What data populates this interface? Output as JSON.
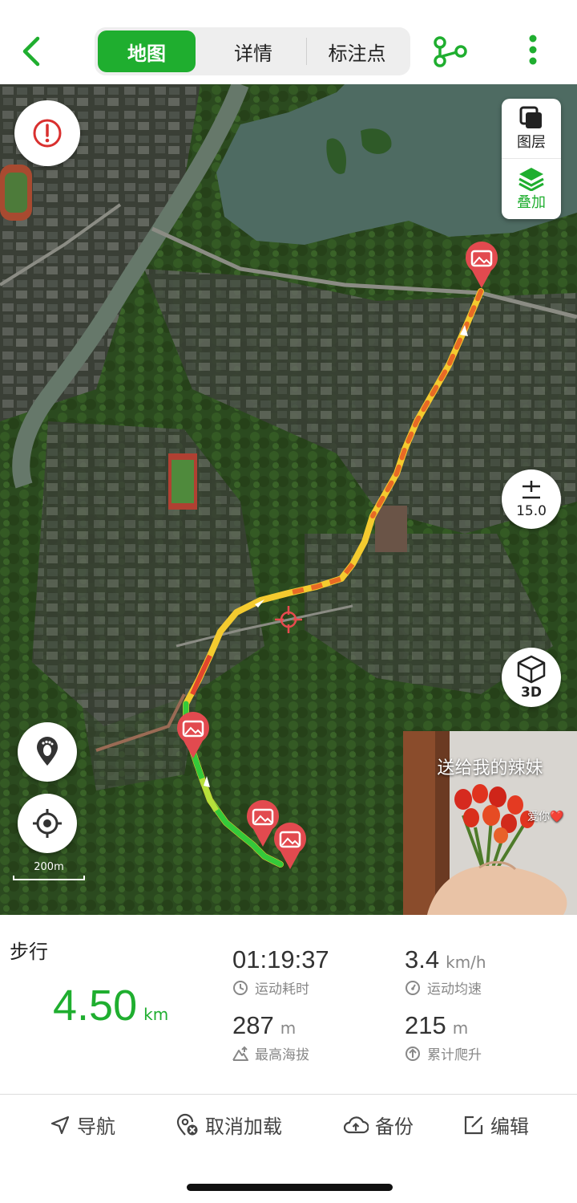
{
  "header": {
    "tabs": [
      {
        "label": "地图",
        "active": true
      },
      {
        "label": "详情",
        "active": false
      },
      {
        "label": "标注点",
        "active": false
      }
    ]
  },
  "map": {
    "layer_label": "图层",
    "overlay_label": "叠加",
    "zoom_level": "15.0",
    "btn_3d": "3D",
    "scale_label": "200m",
    "photo_caption": "送给我的辣妹",
    "photo_small_text": "爱你❤️"
  },
  "stats": {
    "activity_type": "步行",
    "distance": "4.50",
    "distance_unit": "km",
    "duration": "01:19:37",
    "duration_label": "运动耗时",
    "avg_speed": "3.4",
    "avg_speed_unit": "km/h",
    "avg_speed_label": "运动均速",
    "max_altitude": "287",
    "max_altitude_unit": "m",
    "max_altitude_label": "最高海拔",
    "elevation_gain": "215",
    "elevation_gain_unit": "m",
    "elevation_gain_label": "累计爬升"
  },
  "actions": {
    "navigate": "导航",
    "cancel_load": "取消加载",
    "backup": "备份",
    "edit": "编辑"
  },
  "colors": {
    "accent_green": "#1fae2f",
    "marker_red": "#e24a4f",
    "alert_red": "#d9302f"
  }
}
